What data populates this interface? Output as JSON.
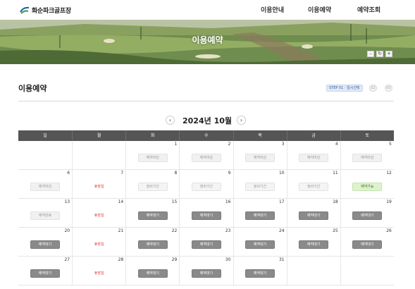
{
  "header": {
    "logo_text": "화순파크골프장",
    "nav": [
      "이용안내",
      "이용예약",
      "예약조회"
    ]
  },
  "banner": {
    "title": "이용예약",
    "controls": [
      "–",
      "↻",
      "+"
    ]
  },
  "page": {
    "title": "이용예약",
    "step_badge": "STEP 01 · 일시선택",
    "step_circles": [
      "02",
      "03"
    ]
  },
  "calendar": {
    "prev_icon": "‹",
    "next_icon": "›",
    "month_label": "2024년 10월",
    "weekdays": [
      "일",
      "월",
      "화",
      "수",
      "목",
      "금",
      "토"
    ],
    "weeks": [
      [
        {
          "day": "",
          "status": "",
          "kind": "none"
        },
        {
          "day": "",
          "status": "",
          "kind": "none"
        },
        {
          "day": "1",
          "status": "예약마감",
          "kind": "closed"
        },
        {
          "day": "2",
          "status": "예약마감",
          "kind": "closed"
        },
        {
          "day": "3",
          "status": "예약마감",
          "kind": "closed"
        },
        {
          "day": "4",
          "status": "예약마감",
          "kind": "closed"
        },
        {
          "day": "5",
          "status": "예약마감",
          "kind": "closed"
        }
      ],
      [
        {
          "day": "6",
          "status": "예약마감",
          "kind": "closed"
        },
        {
          "day": "7",
          "status": "휴장일",
          "kind": "holiday"
        },
        {
          "day": "8",
          "status": "정비기간",
          "kind": "maint"
        },
        {
          "day": "9",
          "status": "정비기간",
          "kind": "maint"
        },
        {
          "day": "10",
          "status": "정비기간",
          "kind": "maint"
        },
        {
          "day": "11",
          "status": "정비기간",
          "kind": "maint"
        },
        {
          "day": "12",
          "status": "예약가능",
          "kind": "avail"
        }
      ],
      [
        {
          "day": "13",
          "status": "예약완료",
          "kind": "done"
        },
        {
          "day": "14",
          "status": "휴장일",
          "kind": "holiday"
        },
        {
          "day": "15",
          "status": "예약대기",
          "kind": "wait"
        },
        {
          "day": "16",
          "status": "예약대기",
          "kind": "wait"
        },
        {
          "day": "17",
          "status": "예약대기",
          "kind": "wait"
        },
        {
          "day": "18",
          "status": "예약대기",
          "kind": "wait"
        },
        {
          "day": "19",
          "status": "예약대기",
          "kind": "wait"
        }
      ],
      [
        {
          "day": "20",
          "status": "예약대기",
          "kind": "wait"
        },
        {
          "day": "21",
          "status": "휴장일",
          "kind": "holiday"
        },
        {
          "day": "22",
          "status": "예약대기",
          "kind": "wait"
        },
        {
          "day": "23",
          "status": "예약대기",
          "kind": "wait"
        },
        {
          "day": "24",
          "status": "예약대기",
          "kind": "wait"
        },
        {
          "day": "25",
          "status": "예약대기",
          "kind": "wait"
        },
        {
          "day": "26",
          "status": "예약대기",
          "kind": "wait"
        }
      ],
      [
        {
          "day": "27",
          "status": "예약대기",
          "kind": "wait"
        },
        {
          "day": "28",
          "status": "휴장일",
          "kind": "holiday"
        },
        {
          "day": "29",
          "status": "예약대기",
          "kind": "wait"
        },
        {
          "day": "30",
          "status": "예약대기",
          "kind": "wait"
        },
        {
          "day": "31",
          "status": "예약대기",
          "kind": "wait"
        },
        {
          "day": "",
          "status": "",
          "kind": "none"
        },
        {
          "day": "",
          "status": "",
          "kind": "none"
        }
      ]
    ]
  },
  "colors": {
    "header_bar": "#555555",
    "holiday_text": "#e2352b",
    "available_bg": "#dff2cf",
    "waiting_bg": "#8a8a8a"
  }
}
